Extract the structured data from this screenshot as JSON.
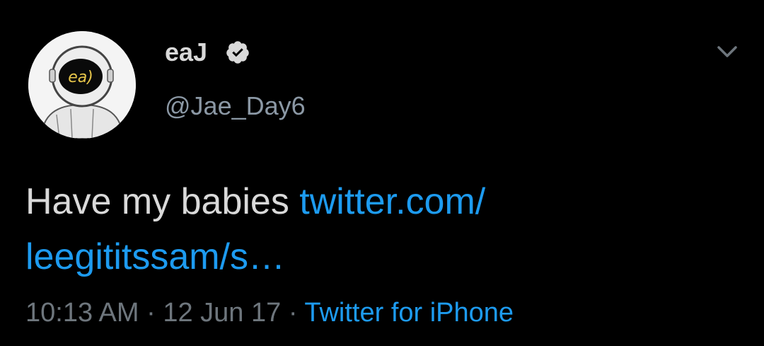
{
  "user": {
    "display_name": "eaJ",
    "handle": "@Jae_Day6",
    "avatar_text": "ea)",
    "verified_icon": "verified-badge-icon"
  },
  "tweet": {
    "text": "Have my babies ",
    "link_line1": "twitter.com/",
    "link_line2": "leegititssam/s…"
  },
  "meta": {
    "time": "10:13 AM",
    "separator": " · ",
    "date": "12 Jun 17",
    "source": "Twitter for iPhone"
  },
  "colors": {
    "background": "#000000",
    "text": "#d9d9d9",
    "secondary": "#8b98a5",
    "link": "#1d9bf0"
  }
}
